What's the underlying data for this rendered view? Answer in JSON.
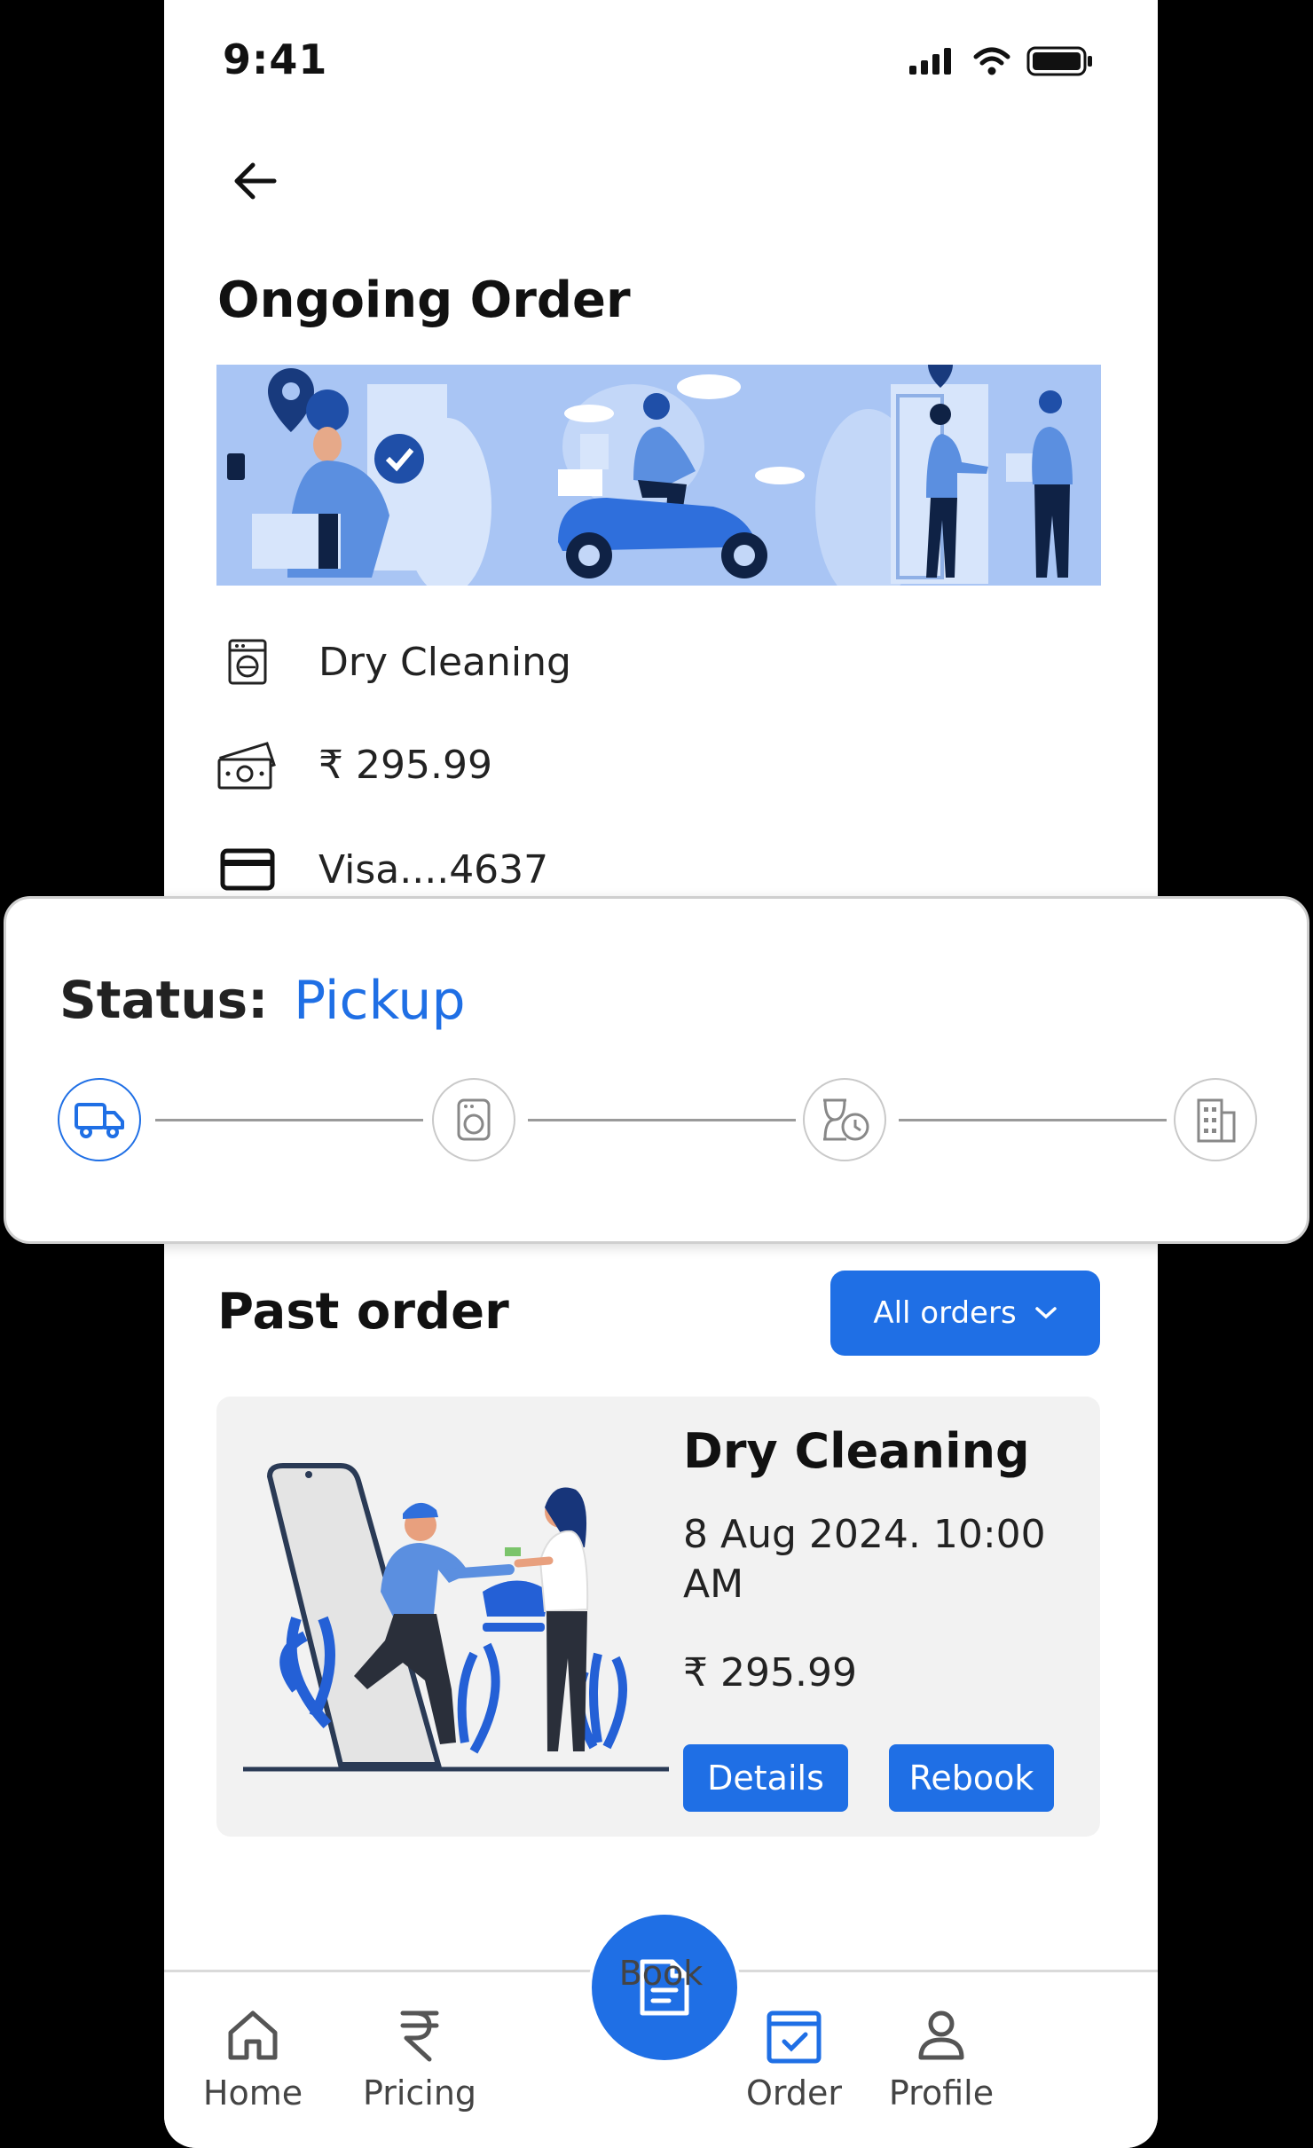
{
  "status_bar": {
    "time": "9:41"
  },
  "header": {
    "title": "Ongoing Order"
  },
  "ongoing": {
    "service": "Dry Cleaning",
    "amount": "₹ 295.99",
    "payment": "Visa....4637"
  },
  "status": {
    "label": "Status:",
    "value": "Pickup",
    "steps": [
      "pickup-truck-icon",
      "washing-machine-icon",
      "processing-clock-icon",
      "delivery-building-icon"
    ]
  },
  "past": {
    "title": "Past order",
    "filter_label": "All orders",
    "order": {
      "service": "Dry Cleaning",
      "date": "8 Aug 2024. 10:00 AM",
      "amount": "₹ 295.99",
      "details_label": "Details",
      "rebook_label": "Rebook"
    }
  },
  "nav": {
    "items": [
      {
        "label": "Home",
        "icon": "home-icon"
      },
      {
        "label": "Pricing",
        "icon": "rupee-icon"
      },
      {
        "label": "Book",
        "icon": "document-icon"
      },
      {
        "label": "Order",
        "icon": "calendar-check-icon"
      },
      {
        "label": "Profile",
        "icon": "user-icon"
      }
    ],
    "active": "Order"
  },
  "colors": {
    "accent": "#1f6fe5",
    "banner": "#a9c5f4",
    "card_bg": "#f2f2f2"
  }
}
